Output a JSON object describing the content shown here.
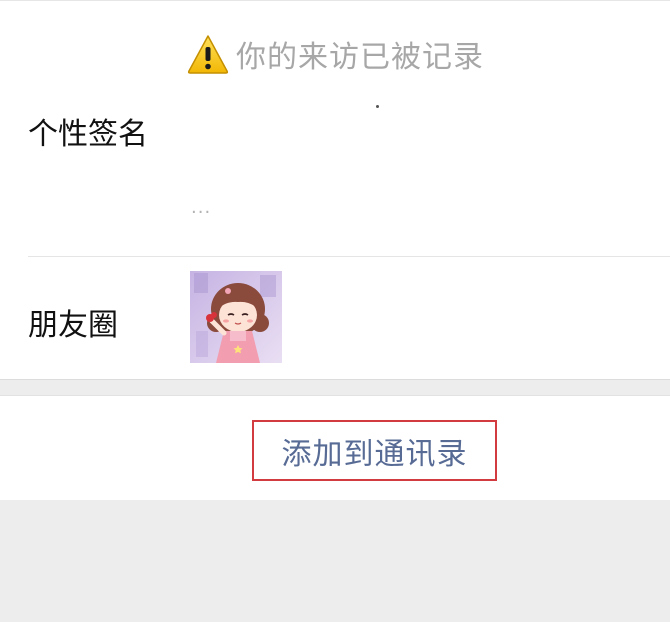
{
  "visit_notice": {
    "icon": "warning-triangle-icon",
    "text": "你的来访已被记录"
  },
  "profile": {
    "signature_label": "个性签名",
    "signature_more": "...",
    "moments_label": "朋友圈",
    "moments_thumbnail": "cartoon-girl-image"
  },
  "actions": {
    "add_to_contacts": "添加到通讯录"
  },
  "colors": {
    "link_blue": "#576b95",
    "highlight_red": "#d23b3f",
    "warning_yellow": "#f7c21b",
    "page_gray": "#ededed"
  }
}
